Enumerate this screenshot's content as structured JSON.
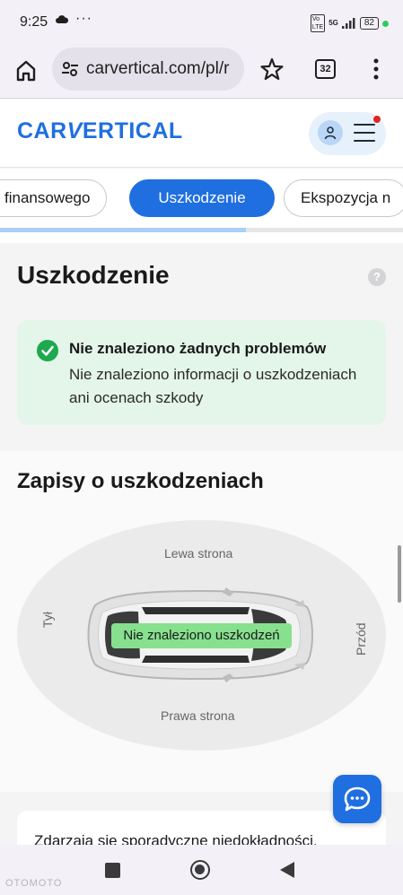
{
  "status_bar": {
    "time": "9:25",
    "extra": "···",
    "network_label": "5G",
    "battery": "82"
  },
  "browser": {
    "url": "carvertical.com/pl/r",
    "tab_count": "32"
  },
  "site": {
    "logo_part1": "CAR",
    "logo_v": "V",
    "logo_part2": "ERTICAL",
    "brand_color": "#1f6fe0"
  },
  "chips": {
    "items": [
      {
        "label": "finansowego"
      },
      {
        "label": "Uszkodzenie"
      },
      {
        "label": "Ekspozycja n"
      }
    ],
    "active_index": 1,
    "progress_fraction": 0.61
  },
  "damage_section": {
    "title": "Uszkodzenie",
    "help": "?",
    "alert_title": "Nie znaleziono żadnych problemów",
    "alert_text": "Nie znaleziono informacji o uszkodzeniach ani ocenach szkody"
  },
  "records_section": {
    "title": "Zapisy o uszkodzeniach",
    "label_left_side": "Lewa strona",
    "label_right_side": "Prawa strona",
    "label_back": "Tył",
    "label_front": "Przód",
    "badge": "Nie znaleziono uszkodzeń"
  },
  "note": {
    "text": "Zdarzają się sporadyczne niedokładności,"
  },
  "watermark": "OTOMOTO"
}
